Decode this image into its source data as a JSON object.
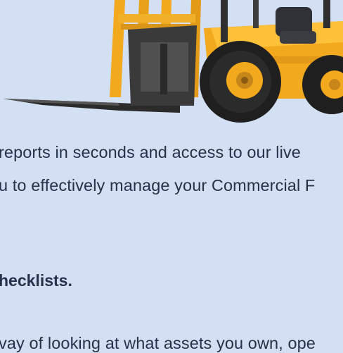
{
  "hero": {
    "icon": "forklift-icon"
  },
  "content": {
    "line1": "reports in seconds and access to our live",
    "line2": "u to effectively manage your Commercial F",
    "heading": "hecklists.",
    "line3": "vay of looking at what assets you own, ope"
  },
  "colors": {
    "background": "#d3dff2",
    "text": "#25324a",
    "forklift_yellow": "#f2a91d",
    "tyre": "#1f1f1f"
  }
}
